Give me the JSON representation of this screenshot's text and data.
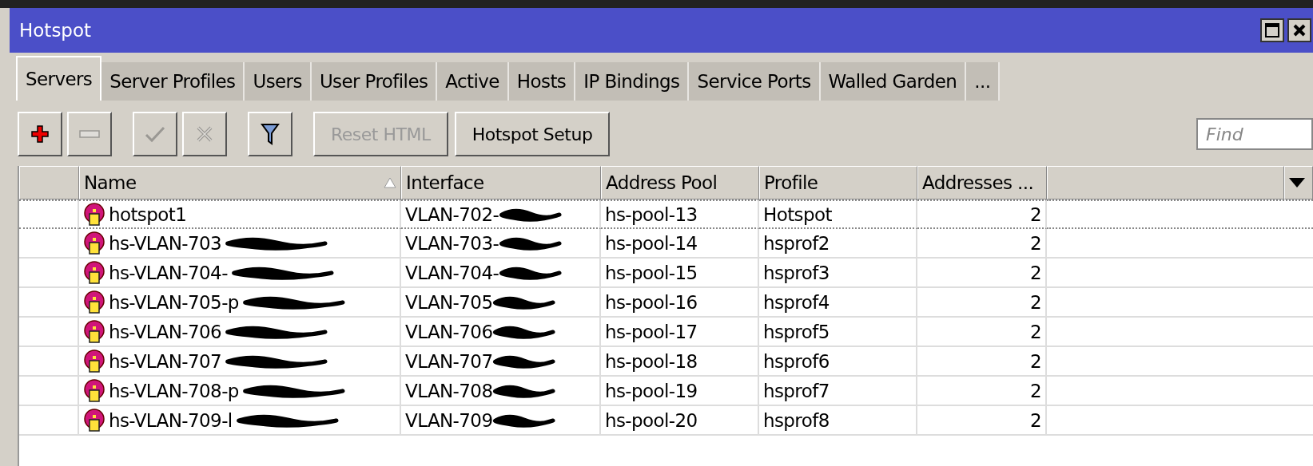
{
  "window": {
    "title": "Hotspot"
  },
  "tabs": [
    {
      "label": "Servers",
      "selected": true
    },
    {
      "label": "Server Profiles",
      "selected": false
    },
    {
      "label": "Users",
      "selected": false
    },
    {
      "label": "User Profiles",
      "selected": false
    },
    {
      "label": "Active",
      "selected": false
    },
    {
      "label": "Hosts",
      "selected": false
    },
    {
      "label": "IP Bindings",
      "selected": false
    },
    {
      "label": "Service Ports",
      "selected": false
    },
    {
      "label": "Walled Garden",
      "selected": false
    },
    {
      "label": "...",
      "selected": false
    }
  ],
  "toolbar": [
    {
      "kind": "add",
      "disabled": false
    },
    {
      "kind": "remove",
      "disabled": true
    },
    {
      "kind": "enable",
      "disabled": true
    },
    {
      "kind": "disable",
      "disabled": true
    },
    {
      "kind": "filter",
      "disabled": false
    },
    {
      "kind": "text",
      "label": "Reset HTML",
      "disabled": true
    },
    {
      "kind": "text",
      "label": "Hotspot Setup",
      "disabled": false
    }
  ],
  "search": {
    "placeholder": "Find"
  },
  "table": {
    "columns": [
      {
        "label": "Name",
        "sorted": true
      },
      {
        "label": "Interface",
        "sorted": false
      },
      {
        "label": "Address Pool",
        "sorted": false
      },
      {
        "label": "Profile",
        "sorted": false
      },
      {
        "label": "Addresses ...",
        "sorted": false
      }
    ],
    "rows": [
      {
        "focused": true,
        "name": "hotspot1",
        "name_redacted": false,
        "interface": "VLAN-702-",
        "interface_redacted": true,
        "pool": "hs-pool-13",
        "profile": "Hotspot",
        "addresses": "2"
      },
      {
        "focused": false,
        "name": "hs-VLAN-703",
        "name_redacted": true,
        "interface": "VLAN-703-",
        "interface_redacted": true,
        "pool": "hs-pool-14",
        "profile": "hsprof2",
        "addresses": "2"
      },
      {
        "focused": false,
        "name": "hs-VLAN-704-",
        "name_redacted": true,
        "interface": "VLAN-704-",
        "interface_redacted": true,
        "pool": "hs-pool-15",
        "profile": "hsprof3",
        "addresses": "2"
      },
      {
        "focused": false,
        "name": "hs-VLAN-705-p",
        "name_redacted": true,
        "interface": "VLAN-705",
        "interface_redacted": true,
        "pool": "hs-pool-16",
        "profile": "hsprof4",
        "addresses": "2"
      },
      {
        "focused": false,
        "name": "hs-VLAN-706",
        "name_redacted": true,
        "interface": "VLAN-706",
        "interface_redacted": true,
        "pool": "hs-pool-17",
        "profile": "hsprof5",
        "addresses": "2"
      },
      {
        "focused": false,
        "name": "hs-VLAN-707",
        "name_redacted": true,
        "interface": "VLAN-707",
        "interface_redacted": true,
        "pool": "hs-pool-18",
        "profile": "hsprof6",
        "addresses": "2"
      },
      {
        "focused": false,
        "name": "hs-VLAN-708-p",
        "name_redacted": true,
        "interface": "VLAN-708",
        "interface_redacted": true,
        "pool": "hs-pool-19",
        "profile": "hsprof7",
        "addresses": "2"
      },
      {
        "focused": false,
        "name": "hs-VLAN-709-l",
        "name_redacted": true,
        "interface": "VLAN-709",
        "interface_redacted": true,
        "pool": "hs-pool-20",
        "profile": "hsprof8",
        "addresses": "2"
      }
    ]
  }
}
